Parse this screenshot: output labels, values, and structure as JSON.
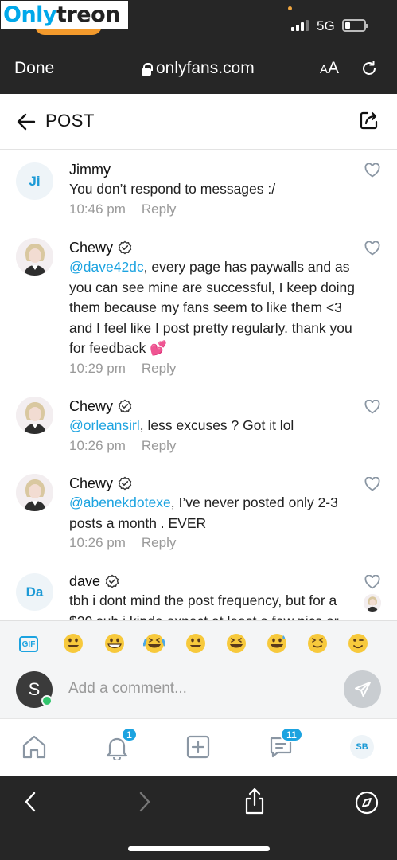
{
  "watermark": {
    "part1": "Only",
    "part2": "treon"
  },
  "status": {
    "network": "5G"
  },
  "browser": {
    "done_label": "Done",
    "url": "onlyfans.com",
    "aa_small": "A",
    "aa_large": "A"
  },
  "post": {
    "title": "POST"
  },
  "comments": [
    {
      "author": "Jimmy",
      "verified": false,
      "avatar_initials": "Ji",
      "avatar_type": "initials",
      "mention": "",
      "text": "You don’t respond to messages :/",
      "time": "10:46 pm",
      "reply_label": "Reply"
    },
    {
      "author": "Chewy",
      "verified": true,
      "avatar_initials": "",
      "avatar_type": "photo",
      "mention": "@dave42dc",
      "text": ", every page has paywalls and as you can see mine are successful, I keep doing them because my fans seem to like them <3 and I feel like I post pretty regularly. thank you for feedback 💕",
      "time": "10:29 pm",
      "reply_label": "Reply"
    },
    {
      "author": "Chewy",
      "verified": true,
      "avatar_initials": "",
      "avatar_type": "photo",
      "mention": "@orleansirl",
      "text": ", less excuses ? Got it lol",
      "time": "10:26 pm",
      "reply_label": "Reply"
    },
    {
      "author": "Chewy",
      "verified": true,
      "avatar_initials": "",
      "avatar_type": "photo",
      "mention": "@abenekdotexe",
      "text": ", I’ve never posted only 2-3 posts a month . EVER",
      "time": "10:26 pm",
      "reply_label": "Reply"
    },
    {
      "author": "dave",
      "verified": true,
      "avatar_initials": "Da",
      "avatar_type": "initials",
      "mention": "",
      "text": "tbh i dont mind the post frequency, but for a $20 sub i kinda expect at least a few pics or",
      "time": "",
      "reply_label": ""
    }
  ],
  "emoji_bar": {
    "gif_label": "GIF",
    "emojis": [
      "grinning-face",
      "beaming-face",
      "tears-of-joy-face",
      "grinning-face",
      "grinning-squinting-face",
      "grinning-sweat-face",
      "squinting-face",
      "winking-face"
    ]
  },
  "comment_input": {
    "placeholder": "Add a comment...",
    "user_initial": "S"
  },
  "bottom_nav": {
    "notifications_badge": "1",
    "messages_badge": "11",
    "profile_initials": "SB"
  },
  "colors": {
    "accent": "#1ca3e0",
    "online": "#32c56d",
    "dark_bar": "#262626"
  }
}
